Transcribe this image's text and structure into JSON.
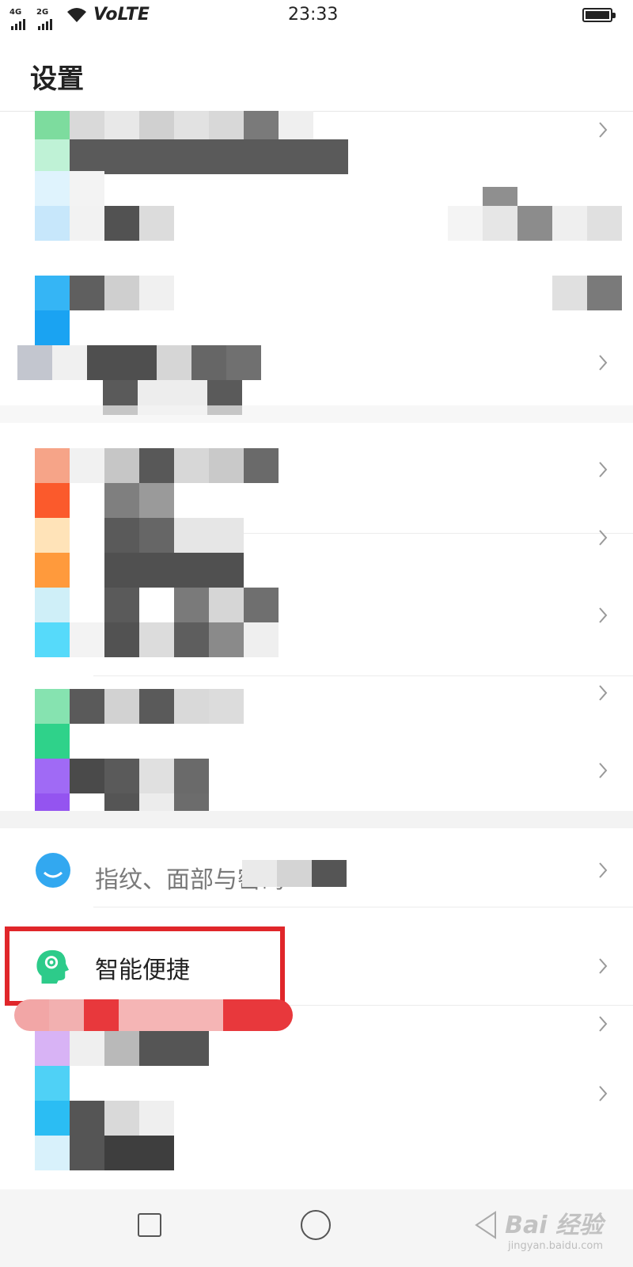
{
  "status_bar": {
    "network_1": "4G",
    "network_2": "2G",
    "volte": "VoLTE",
    "time": "23:33",
    "icons": [
      "signal-icon",
      "wifi-icon",
      "battery-icon"
    ]
  },
  "header": {
    "title": "设置"
  },
  "settings_rows": [
    {
      "label": "",
      "redacted": true,
      "icon": "blurred-icon"
    },
    {
      "label": "",
      "redacted": true,
      "icon": "blurred-icon"
    },
    {
      "label": "",
      "redacted": true,
      "icon": "blurred-icon"
    },
    {
      "label": "",
      "redacted": true,
      "icon": "blurred-icon"
    },
    {
      "label": "",
      "redacted": true,
      "icon": "blurred-icon"
    },
    {
      "label": "",
      "redacted": true,
      "icon": "blurred-icon"
    },
    {
      "label": "",
      "redacted": true,
      "icon": "blurred-icon"
    },
    {
      "label": "",
      "redacted": true,
      "icon": "blurred-icon"
    },
    {
      "label": "",
      "redacted": true,
      "icon": "blurred-icon"
    },
    {
      "label": "指纹、面部与密码",
      "redacted": true,
      "icon": "fingerprint-icon"
    },
    {
      "label": "智能便捷",
      "redacted": false,
      "icon": "smart-head-icon",
      "highlighted": true
    },
    {
      "label": "",
      "redacted": true,
      "icon": "blurred-icon"
    },
    {
      "label": "",
      "redacted": true,
      "icon": "blurred-icon"
    }
  ],
  "colors": {
    "highlight": "#e0262a",
    "accent_green": "#2dcb8a"
  },
  "navbar": {
    "icons": [
      "recent-apps-icon",
      "home-icon",
      "back-icon"
    ]
  },
  "watermark": {
    "main": "Bai 经验",
    "sub": "jingyan.baidu.com"
  }
}
